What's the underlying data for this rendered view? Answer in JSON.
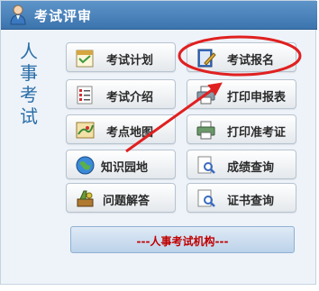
{
  "header": {
    "title": "考试评审",
    "icon": "user-icon"
  },
  "side_title": [
    "人",
    "事",
    "考",
    "试"
  ],
  "buttons": {
    "exam_plan": {
      "label": "考试计划",
      "icon": "calendar-icon"
    },
    "exam_register": {
      "label": "考试报名",
      "icon": "pen-notepad-icon"
    },
    "exam_intro": {
      "label": "考试介绍",
      "icon": "list-document-icon"
    },
    "print_form": {
      "label": "打印申报表",
      "icon": "printer-icon"
    },
    "exam_location": {
      "label": "考点地图",
      "icon": "map-icon"
    },
    "print_ticket": {
      "label": "打印准考证",
      "icon": "printer-icon"
    },
    "knowledge": {
      "label": "知识园地",
      "icon": "globe-icon"
    },
    "score_query": {
      "label": "成绩查询",
      "icon": "magnifier-document-icon"
    },
    "faq": {
      "label": "问题解答",
      "icon": "tools-icon"
    },
    "cert_query": {
      "label": "证书查询",
      "icon": "magnifier-document-icon"
    }
  },
  "org_link": {
    "label": "---人事考试机构---"
  },
  "colors": {
    "header": "#4a85bf",
    "accent_red": "#c00000",
    "annotation_red": "#e02020"
  }
}
